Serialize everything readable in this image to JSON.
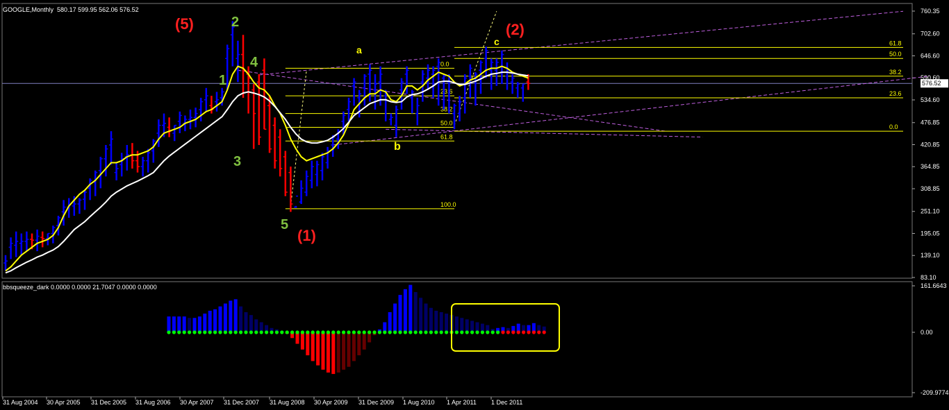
{
  "chart_data": [
    {
      "type": "line",
      "title": "GOOGLE,Monthly",
      "ohlc_summary": "580.17 599.95 562.06 576.52",
      "current_price": "576.52",
      "y_ticks": [
        "760.35",
        "702.60",
        "646.60",
        "590.60",
        "534.60",
        "476.85",
        "420.85",
        "364.85",
        "308.85",
        "251.10",
        "195.05",
        "139.10",
        "83.10"
      ],
      "ylim": [
        83.1,
        760.35
      ],
      "x_ticks": [
        "31 Aug 2004",
        "30 Apr 2005",
        "31 Dec 2005",
        "31 Aug 2006",
        "30 Apr 2007",
        "31 Dec 2007",
        "31 Aug 2008",
        "30 Apr 2009",
        "31 Dec 2009",
        "1 Aug 2010",
        "1 Apr 2011",
        "1 Dec 2011"
      ],
      "bars": {
        "x_index": [
          0,
          1,
          2,
          3,
          4,
          5,
          6,
          7,
          8,
          9,
          10,
          11,
          12,
          13,
          14,
          15,
          16,
          17,
          18,
          19,
          20,
          21,
          22,
          23,
          24,
          25,
          26,
          27,
          28,
          29,
          30,
          31,
          32,
          33,
          34,
          35,
          36,
          37,
          38,
          39,
          40,
          41,
          42,
          43,
          44,
          45,
          46,
          47,
          48,
          49,
          50,
          51,
          52,
          53,
          54,
          55,
          56,
          57,
          58,
          59,
          60,
          61,
          62,
          63,
          64,
          65,
          66,
          67,
          68,
          69,
          70,
          71,
          72,
          73,
          74,
          75,
          76,
          77,
          78,
          79,
          80,
          81,
          82,
          83,
          84,
          85,
          86,
          87,
          88,
          89,
          90,
          91,
          92,
          93,
          94,
          95,
          96,
          97,
          98,
          99
        ],
        "high": [
          140,
          185,
          200,
          195,
          200,
          195,
          205,
          200,
          195,
          215,
          240,
          280,
          285,
          290,
          285,
          305,
          335,
          355,
          390,
          420,
          455,
          375,
          400,
          420,
          425,
          405,
          390,
          410,
          435,
          485,
          500,
          490,
          470,
          505,
          495,
          510,
          515,
          540,
          565,
          545,
          555,
          565,
          675,
          735,
          685,
          700,
          620,
          575,
          600,
          640,
          545,
          490,
          460,
          405,
          365,
          265,
          330,
          355,
          380,
          380,
          400,
          415,
          445,
          460,
          505,
          540,
          590,
          560,
          600,
          625,
          600,
          620,
          560,
          500,
          520,
          590,
          620,
          560,
          540,
          610,
          625,
          620,
          640,
          600,
          600,
          525,
          545,
          600,
          625,
          605,
          635,
          670,
          640,
          640,
          660,
          630,
          600,
          580,
          575,
          600
        ],
        "low": [
          100,
          130,
          135,
          140,
          150,
          155,
          150,
          160,
          165,
          170,
          190,
          215,
          235,
          240,
          245,
          255,
          280,
          290,
          310,
          340,
          370,
          330,
          340,
          355,
          360,
          350,
          340,
          350,
          375,
          415,
          440,
          440,
          430,
          450,
          455,
          460,
          465,
          480,
          505,
          500,
          505,
          520,
          560,
          620,
          580,
          540,
          500,
          410,
          420,
          460,
          400,
          360,
          340,
          290,
          250,
          260,
          270,
          290,
          310,
          315,
          330,
          360,
          390,
          410,
          445,
          480,
          520,
          490,
          520,
          530,
          510,
          520,
          480,
          470,
          440,
          510,
          550,
          500,
          470,
          530,
          560,
          540,
          520,
          510,
          500,
          460,
          480,
          500,
          540,
          520,
          550,
          590,
          560,
          570,
          575,
          560,
          550,
          540,
          530,
          560
        ],
        "open": [
          120,
          160,
          165,
          170,
          175,
          180,
          178,
          185,
          182,
          195,
          215,
          250,
          262,
          265,
          270,
          282,
          310,
          325,
          355,
          385,
          420,
          350,
          370,
          390,
          395,
          380,
          365,
          380,
          405,
          450,
          470,
          465,
          450,
          480,
          475,
          485,
          490,
          510,
          535,
          520,
          530,
          540,
          640,
          700,
          640,
          650,
          600,
          560,
          580,
          610,
          520,
          470,
          440,
          390,
          350,
          262,
          275,
          300,
          330,
          345,
          355,
          375,
          420,
          435,
          480,
          510,
          570,
          540,
          565,
          600,
          560,
          580,
          545,
          485,
          470,
          560,
          600,
          540,
          500,
          580,
          590,
          600,
          620,
          590,
          580,
          500,
          500,
          540,
          595,
          590,
          610,
          640,
          610,
          610,
          620,
          595,
          580,
          565,
          565,
          580
        ],
        "close": [
          125,
          170,
          175,
          175,
          180,
          178,
          188,
          182,
          195,
          210,
          235,
          262,
          268,
          270,
          280,
          300,
          330,
          350,
          385,
          410,
          435,
          360,
          385,
          395,
          380,
          365,
          380,
          400,
          430,
          470,
          475,
          455,
          470,
          495,
          485,
          490,
          500,
          530,
          545,
          510,
          535,
          555,
          665,
          720,
          650,
          610,
          590,
          500,
          440,
          460,
          410,
          380,
          360,
          300,
          270,
          290,
          310,
          340,
          365,
          370,
          390,
          405,
          440,
          455,
          495,
          530,
          580,
          550,
          595,
          610,
          575,
          600,
          550,
          490,
          510,
          580,
          610,
          555,
          520,
          600,
          610,
          610,
          630,
          595,
          590,
          520,
          530,
          590,
          615,
          600,
          630,
          660,
          630,
          630,
          650,
          610,
          590,
          575,
          575,
          576.52
        ],
        "up_color": "#0000ff",
        "down_color": "#ff0000"
      },
      "series": [
        {
          "role": "fast-ma",
          "color": "#ffff00",
          "values": [
            100,
            110,
            125,
            140,
            150,
            160,
            170,
            175,
            180,
            190,
            210,
            240,
            265,
            280,
            295,
            305,
            320,
            330,
            345,
            360,
            375,
            375,
            380,
            390,
            395,
            395,
            400,
            405,
            415,
            435,
            450,
            455,
            460,
            465,
            475,
            480,
            485,
            495,
            505,
            510,
            520,
            530,
            560,
            600,
            620,
            615,
            600,
            580,
            565,
            560,
            545,
            520,
            500,
            470,
            435,
            410,
            390,
            380,
            385,
            390,
            395,
            400,
            410,
            425,
            445,
            475,
            510,
            525,
            540,
            550,
            550,
            560,
            555,
            535,
            530,
            545,
            570,
            570,
            560,
            570,
            585,
            595,
            605,
            600,
            595,
            580,
            570,
            575,
            585,
            590,
            600,
            610,
            615,
            615,
            620,
            615,
            605,
            600,
            595,
            590
          ]
        },
        {
          "role": "slow-ma",
          "color": "#ffffff",
          "values": [
            95,
            100,
            108,
            115,
            122,
            128,
            135,
            140,
            147,
            153,
            162,
            175,
            190,
            205,
            215,
            225,
            238,
            250,
            262,
            275,
            290,
            300,
            308,
            316,
            322,
            328,
            335,
            342,
            350,
            365,
            380,
            392,
            402,
            412,
            422,
            432,
            442,
            452,
            462,
            472,
            482,
            492,
            510,
            530,
            545,
            552,
            555,
            552,
            548,
            542,
            532,
            518,
            502,
            485,
            465,
            448,
            435,
            428,
            425,
            425,
            428,
            432,
            440,
            450,
            462,
            478,
            495,
            505,
            515,
            525,
            530,
            535,
            535,
            530,
            528,
            530,
            542,
            548,
            550,
            555,
            562,
            570,
            580,
            582,
            582,
            578,
            574,
            574,
            578,
            582,
            588,
            595,
            600,
            602,
            605,
            605,
            603,
            600,
            598,
            596
          ]
        }
      ],
      "fibonacci": [
        {
          "levels": [
            "0.0",
            "23.6",
            "38.2",
            "50.0",
            "61.8",
            "100.0"
          ],
          "prices": [
            615,
            545,
            500,
            465,
            430,
            258
          ]
        },
        {
          "levels": [
            "61.8",
            "50.0",
            "38.2",
            "23.6",
            "0.0"
          ],
          "prices": [
            668,
            640,
            595,
            540,
            455
          ]
        }
      ],
      "wave_labels": [
        "(5)",
        "2",
        "1",
        "4",
        "3",
        "5",
        "(1)",
        "a",
        "b",
        "c",
        "(2)"
      ]
    },
    {
      "type": "bar",
      "title": "bbsqueeze_dark 0.0000 0.0000 21.7047 0.0000 0.0000",
      "y_ticks": [
        "161.6643",
        "0.00",
        "-209.9774"
      ],
      "ylim": [
        -209.9774,
        161.6643
      ],
      "values": [
        55,
        55,
        55,
        55,
        50,
        50,
        55,
        65,
        75,
        80,
        90,
        100,
        110,
        115,
        90,
        70,
        60,
        45,
        35,
        25,
        15,
        10,
        5,
        -5,
        -20,
        -40,
        -60,
        -80,
        -100,
        -115,
        -130,
        -140,
        -145,
        -140,
        -130,
        -120,
        -100,
        -80,
        -60,
        -35,
        -10,
        10,
        35,
        70,
        100,
        130,
        150,
        165,
        140,
        120,
        100,
        85,
        75,
        70,
        65,
        60,
        55,
        50,
        45,
        40,
        35,
        30,
        25,
        12,
        15,
        18,
        15,
        22,
        30,
        25,
        25,
        32,
        25,
        20
      ],
      "colors_by_sign": {
        "positive_strong": "#0000ff",
        "positive_weak": "#000066",
        "negative_strong": "#ff0000",
        "negative_weak": "#660000"
      },
      "squeeze_dots": {
        "on_color": "#00ff00",
        "off_color": "#ff0000",
        "off_indexes": [
          65,
          66,
          67,
          68,
          69,
          70,
          71,
          72,
          73,
          74,
          75,
          76,
          77
        ]
      },
      "highlight_color": "#ffff00"
    }
  ]
}
